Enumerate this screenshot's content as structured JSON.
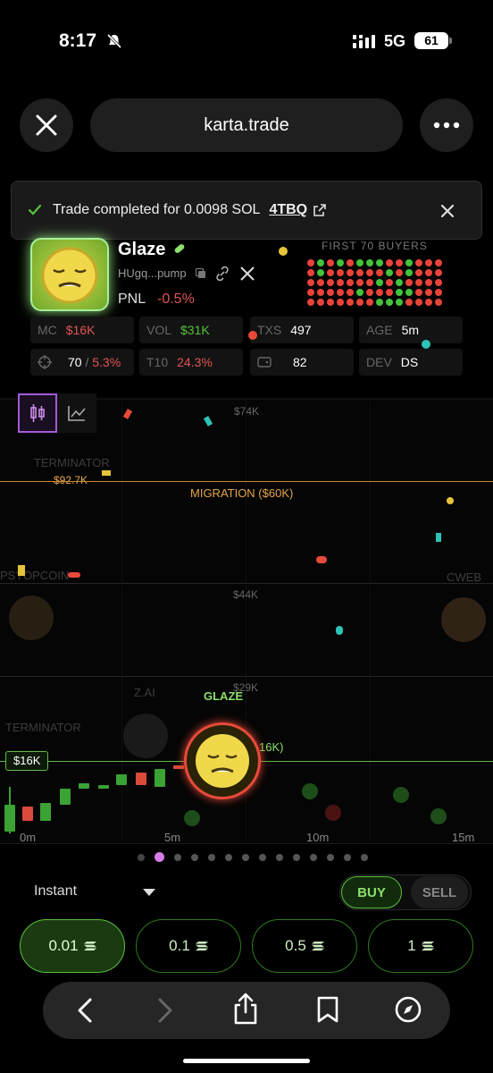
{
  "status_bar": {
    "time": "8:17",
    "network": "5G",
    "battery": "61"
  },
  "browser": {
    "url": "karta.trade"
  },
  "toast": {
    "text": "Trade completed for 0.0098 SOL",
    "tx_hash": "4TBQ"
  },
  "token": {
    "name": "Glaze",
    "address": "HUgq...pump",
    "pnl_label": "PNL",
    "pnl_value": "-0.5%"
  },
  "buyers": {
    "title": "FIRST 70 BUYERS",
    "pattern": "RGRGRGGGRRGRRRRGRRRRRRGRGRRRRRRRRRRGRGRRRRRRRRRGRRRGGRRRRRRRRRRGGGRRRR",
    "colors": {
      "red": "#e8433a",
      "green": "#43c33b"
    }
  },
  "stats": {
    "mc": {
      "label": "MC",
      "value": "$16K"
    },
    "vol": {
      "label": "VOL",
      "value": "$31K"
    },
    "txs": {
      "label": "TXS",
      "value": "497"
    },
    "age": {
      "label": "AGE",
      "value": "5m"
    },
    "holders": {
      "value_a": "70",
      "sep": " / ",
      "value_b": "5.3%"
    },
    "t10": {
      "label": "T10",
      "value": "24.3%"
    },
    "wallet": {
      "value": "82"
    },
    "dev": {
      "label": "DEV",
      "value": "DS"
    }
  },
  "chart": {
    "price_labels": {
      "p74k": "$74K",
      "p44k": "$44K",
      "p29k": "$29K",
      "p92k": "$92.7K",
      "current": "$16K",
      "current_suffix": "16K)"
    },
    "migration_label": "MIGRATION ($60K)",
    "ghost_labels": {
      "terminator_top": "TERMINATOR",
      "terminator_bottom": "TERMINATOR",
      "psyopcoin": "PSYOPCOIN",
      "cweb": "CWEB",
      "zai": "Z.AI"
    },
    "glaze_label": "GLAZE",
    "time_labels": [
      "0m",
      "5m",
      "10m",
      "15m"
    ]
  },
  "controls": {
    "mode": "Instant",
    "buy": "BUY",
    "sell": "SELL",
    "amounts": [
      "0.01",
      "0.1",
      "0.5",
      "1"
    ]
  },
  "colors": {
    "accent_green": "#56c23a",
    "loss_red": "#e25555",
    "migration_orange": "#e6a44a"
  }
}
